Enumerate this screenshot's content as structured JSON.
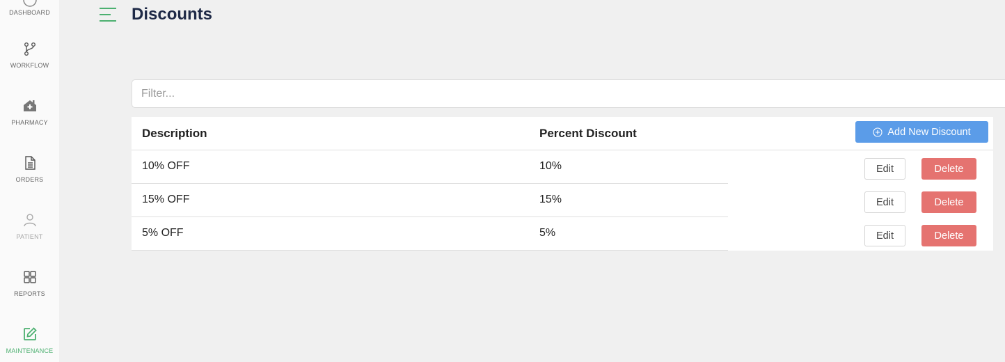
{
  "colors": {
    "accent": "#4cb070",
    "primary": "#5b9ce8",
    "danger": "#e57370",
    "title": "#1f2a47"
  },
  "sidebar": {
    "items": [
      {
        "label": "DASHBOARD",
        "icon": "dashboard-icon"
      },
      {
        "label": "WORKFLOW",
        "icon": "workflow-icon"
      },
      {
        "label": "PHARMACY",
        "icon": "pharmacy-icon"
      },
      {
        "label": "ORDERS",
        "icon": "orders-icon"
      },
      {
        "label": "PATIENT",
        "icon": "patient-icon"
      },
      {
        "label": "REPORTS",
        "icon": "reports-icon"
      },
      {
        "label": "MAINTENANCE",
        "icon": "maintenance-icon",
        "active": true
      }
    ]
  },
  "header": {
    "title": "Discounts",
    "menu_icon": "menu-icon"
  },
  "filter": {
    "placeholder": "Filter..."
  },
  "table": {
    "columns": [
      "Description",
      "Percent Discount"
    ],
    "add_button": "Add New Discount",
    "rows": [
      {
        "description": "10% OFF",
        "percent": "10%"
      },
      {
        "description": "15% OFF",
        "percent": "15%"
      },
      {
        "description": "5% OFF",
        "percent": "5%"
      }
    ],
    "edit_label": "Edit",
    "delete_label": "Delete"
  }
}
